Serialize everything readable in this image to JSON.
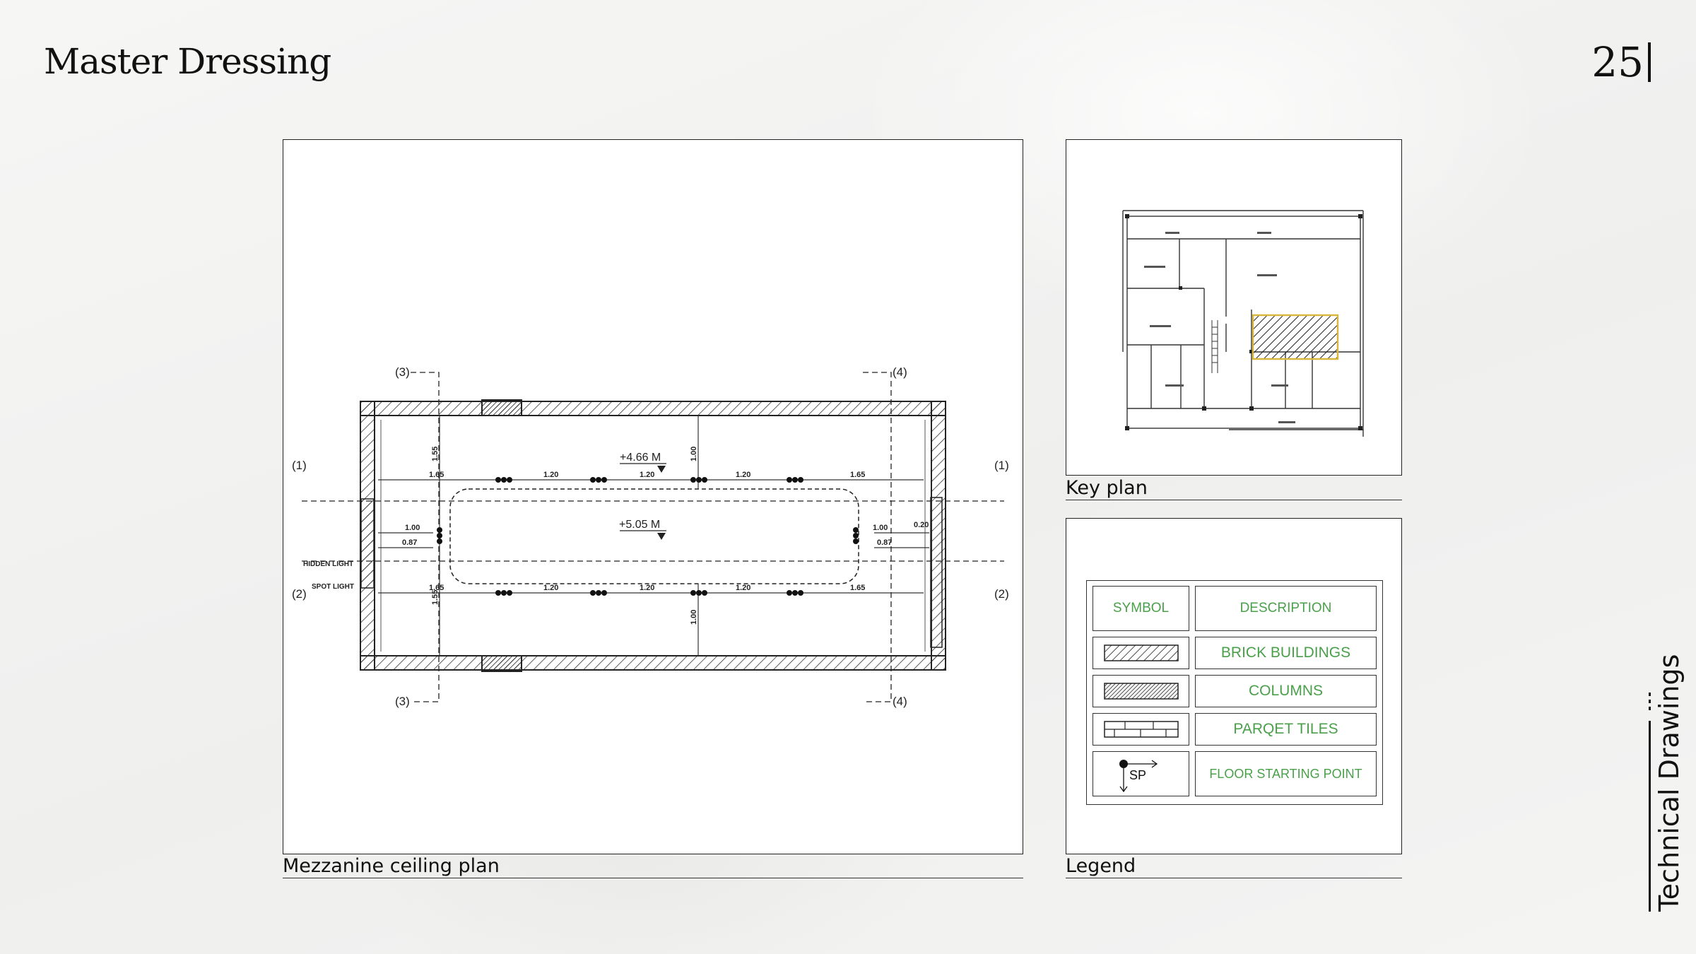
{
  "header": {
    "title": "Master Dressing",
    "page_number": "25"
  },
  "side_label": "Technical Drawings",
  "ceiling_plan": {
    "caption": "Mezzanine ceiling plan",
    "levels": [
      "+4.66 M",
      "+5.05 M"
    ],
    "section_markers": [
      "(1)",
      "(1)",
      "(2)",
      "(2)",
      "(3)",
      "(3)",
      "(4)",
      "(4)"
    ],
    "light_labels": [
      "HIDDEN LIGHT",
      "SPOT LIGHT"
    ],
    "dimensions": {
      "top_row": [
        "1.65",
        "1.20",
        "1.20",
        "1.20",
        "1.65"
      ],
      "bottom_row": [
        "1.65",
        "1.20",
        "1.20",
        "1.20",
        "1.65"
      ],
      "vertical": [
        "1.55",
        "1.00",
        "1.00",
        "1.55",
        "0.20"
      ],
      "side_left": [
        "1.00",
        "0.87"
      ],
      "side_right": [
        "1.00",
        "0.87"
      ]
    }
  },
  "key_plan": {
    "caption": "Key plan"
  },
  "legend": {
    "caption": "Legend",
    "header": {
      "symbol": "SYMBOL",
      "description": "DESCRIPTION"
    },
    "rows": [
      {
        "symbol": "brick-hatch-icon",
        "description": "BRICK BUILDINGS"
      },
      {
        "symbol": "column-hatch-icon",
        "description": "COLUMNS"
      },
      {
        "symbol": "parquet-tile-icon",
        "description": "PARQET TILES"
      },
      {
        "symbol": "starting-point-icon",
        "symbol_text": "SP",
        "description": "FLOOR STARTING POINT"
      }
    ],
    "text_color": "#4aa04a"
  }
}
